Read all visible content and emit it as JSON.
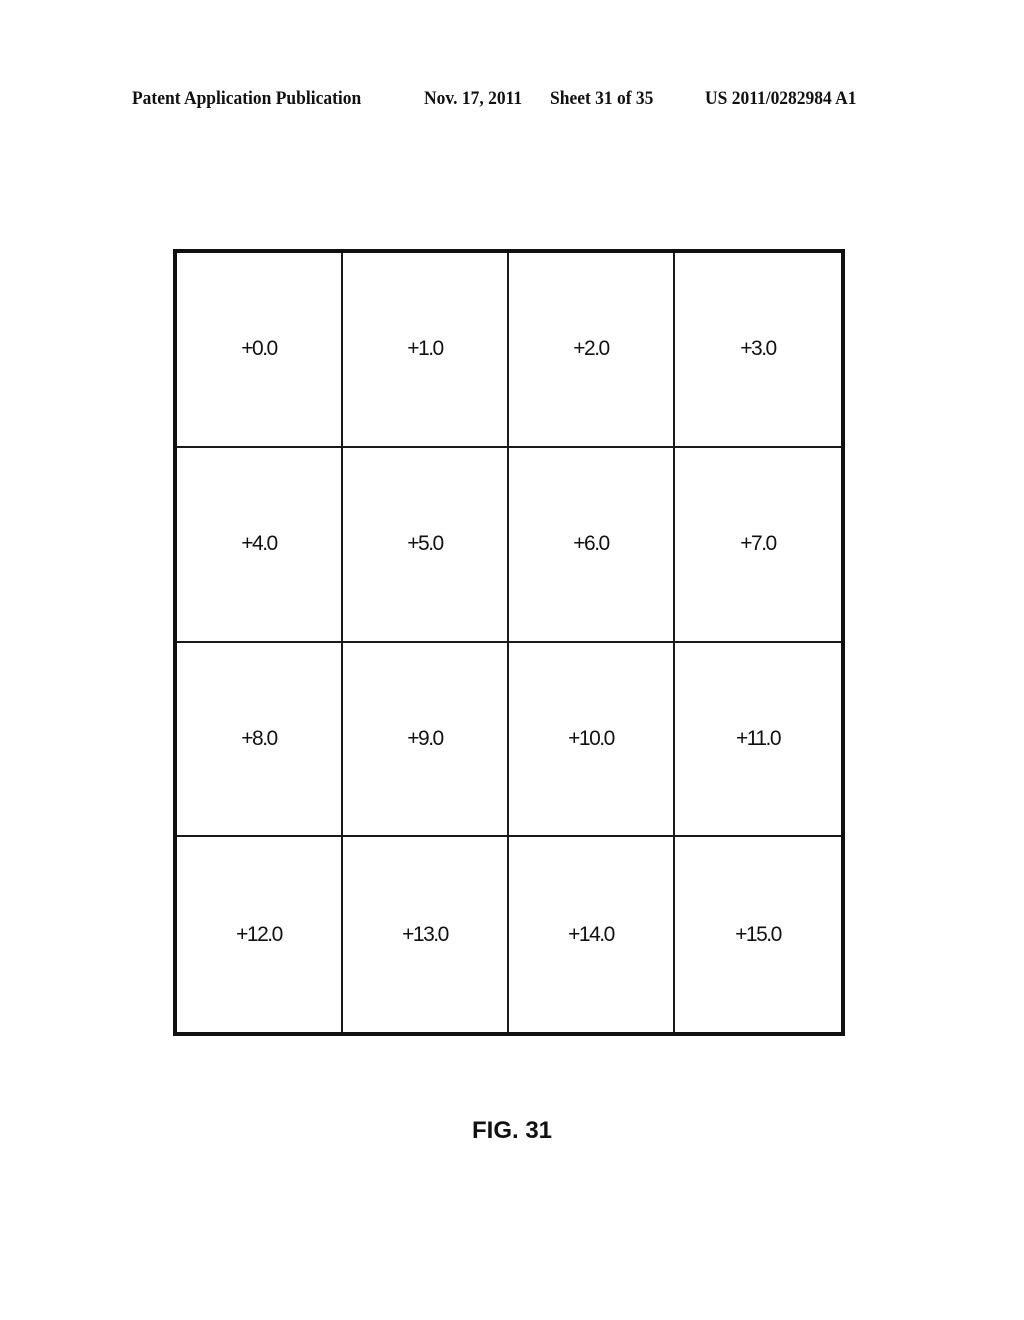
{
  "header": {
    "publication": "Patent Application Publication",
    "date": "Nov. 17, 2011",
    "sheet": "Sheet 31 of 35",
    "number": "US 2011/0282984 A1"
  },
  "grid": {
    "rows": [
      [
        "+0.0",
        "+1.0",
        "+2.0",
        "+3.0"
      ],
      [
        "+4.0",
        "+5.0",
        "+6.0",
        "+7.0"
      ],
      [
        "+8.0",
        "+9.0",
        "+10.0",
        "+11.0"
      ],
      [
        "+12.0",
        "+13.0",
        "+14.0",
        "+15.0"
      ]
    ]
  },
  "caption": "FIG. 31"
}
